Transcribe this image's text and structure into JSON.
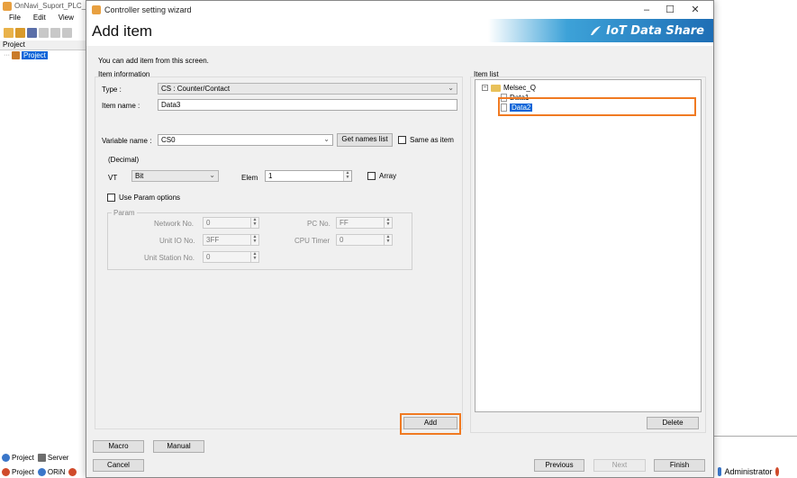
{
  "bg": {
    "title": "OnNavi_Suport_PLC_M",
    "menu": [
      "File",
      "Edit",
      "View"
    ],
    "project_header": "Project",
    "tree_node": "Project",
    "tabs_row1": [
      "Project",
      "Server"
    ],
    "tabs_row2": [
      "Project",
      "ORiN"
    ],
    "status_user": "Administrator"
  },
  "dialog": {
    "title": "Controller setting wizard",
    "heading": "Add item",
    "brand": "IoT Data Share",
    "subtitle": "You can add item from this screen.",
    "window_buttons": [
      "–",
      "☐",
      "✕"
    ]
  },
  "item_info": {
    "section": "Item information",
    "type_label": "Type :",
    "type_value": "CS : Counter/Contact",
    "name_label": "Item name :",
    "name_value": "Data3",
    "var_label": "Variable name :",
    "var_value": "CS0",
    "get_names": "Get names list",
    "same_as_item": "Same as item",
    "decimal": "(Decimal)",
    "vt_label": "VT",
    "vt_value": "Bit",
    "elem_label": "Elem",
    "elem_value": "1",
    "array_label": "Array",
    "use_param": "Use Param options"
  },
  "param": {
    "legend": "Param",
    "network_label": "Network No.",
    "network_value": "0",
    "unit_io_label": "Unit IO No.",
    "unit_io_value": "3FF",
    "unit_station_label": "Unit Station No.",
    "unit_station_value": "0",
    "pc_label": "PC No.",
    "pc_value": "FF",
    "cpu_timer_label": "CPU Timer",
    "cpu_timer_value": "0"
  },
  "item_list": {
    "section": "Item list",
    "root": "Melsec_Q",
    "items": [
      "Data1",
      "Data2"
    ],
    "selected": "Data2",
    "delete": "Delete"
  },
  "buttons": {
    "add": "Add",
    "macro": "Macro",
    "manual": "Manual",
    "cancel": "Cancel",
    "previous": "Previous",
    "next": "Next",
    "finish": "Finish"
  },
  "colors": {
    "highlight": "#f07a22",
    "selection": "#0a64d8",
    "brand_dark": "#1e6eb5"
  }
}
